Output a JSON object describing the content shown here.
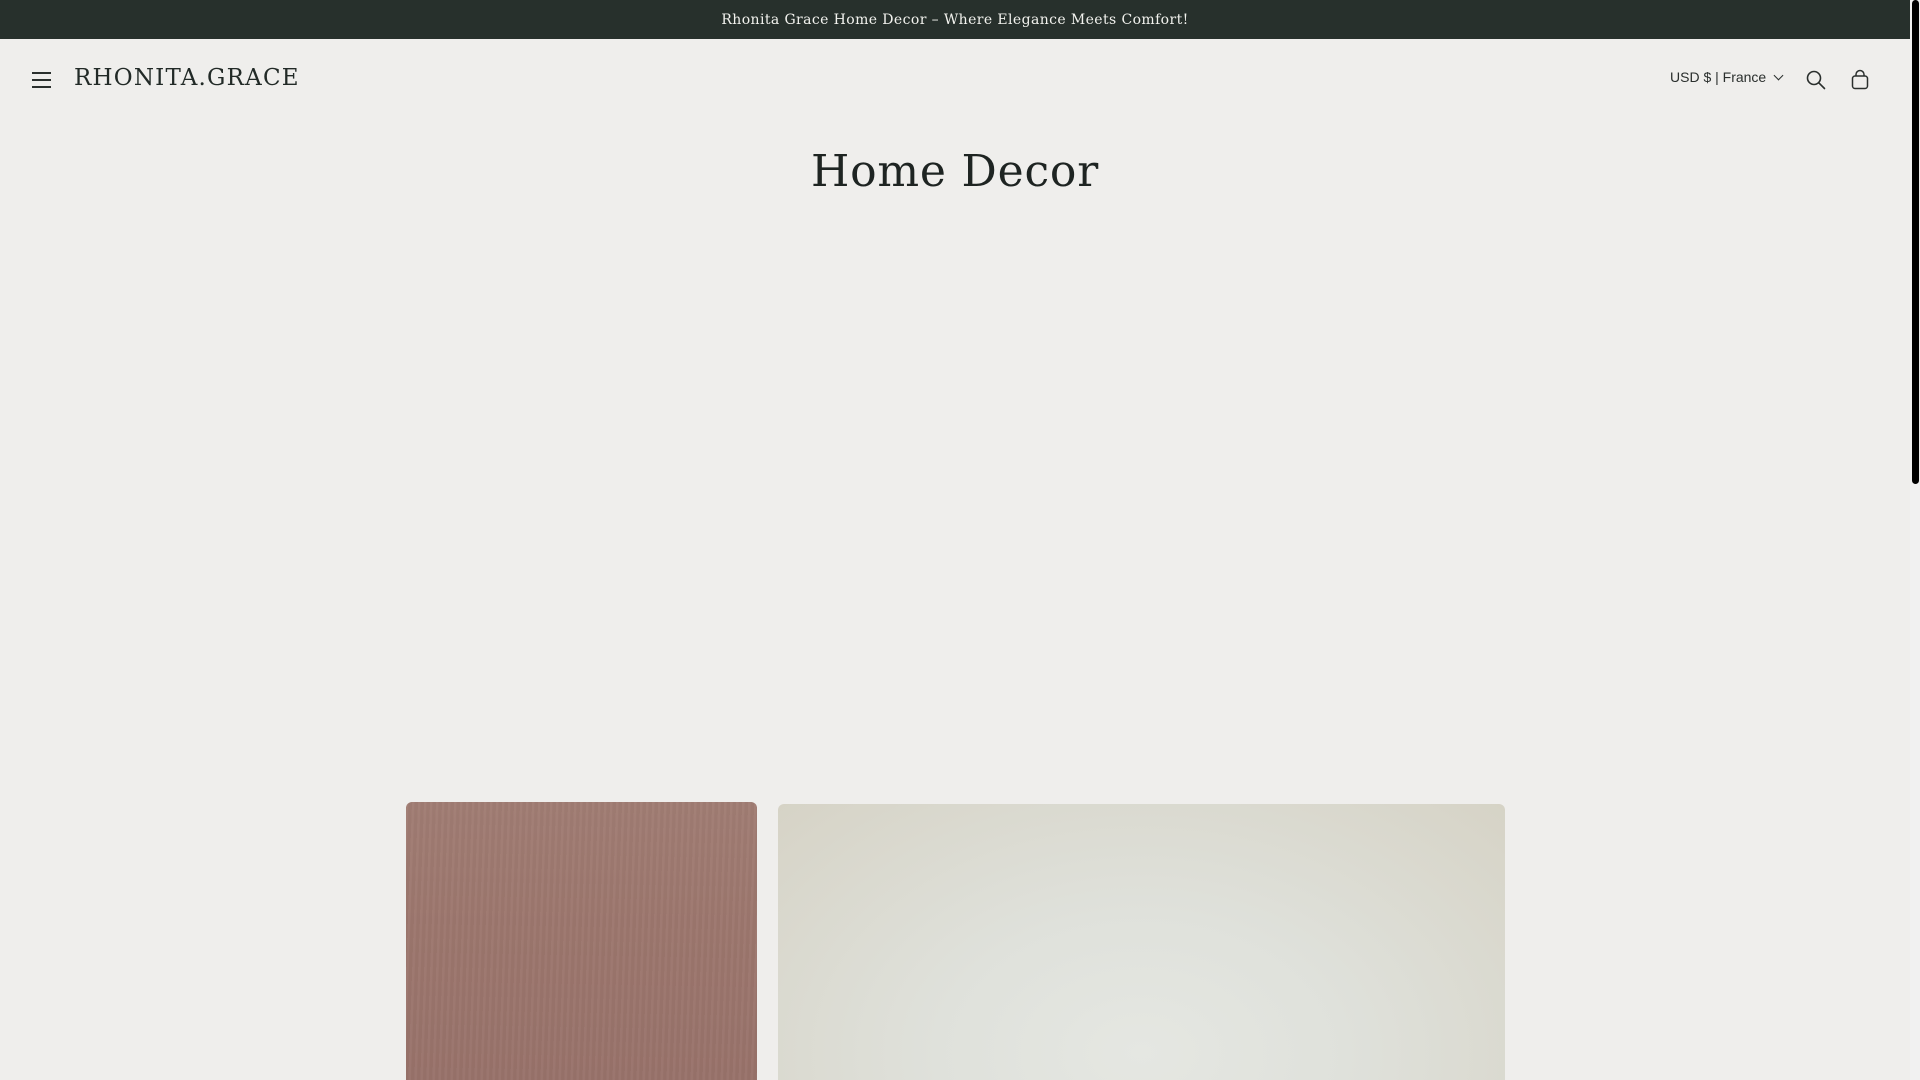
{
  "announcement": {
    "text": "Rhonita Grace Home Decor – Where Elegance Meets Comfort!"
  },
  "header": {
    "logo": "RHONITA.GRACE",
    "currency_selector": "USD $ | France",
    "icons": {
      "menu": "menu-icon",
      "search": "search-icon",
      "cart": "cart-icon",
      "chevron": "chevron-down-icon"
    }
  },
  "page": {
    "title": "Home Decor"
  },
  "colors": {
    "announcement_bg": "#27302c",
    "page_bg": "#efeeec",
    "card_1": "#9c766d",
    "card_2": "#dfe1db"
  }
}
